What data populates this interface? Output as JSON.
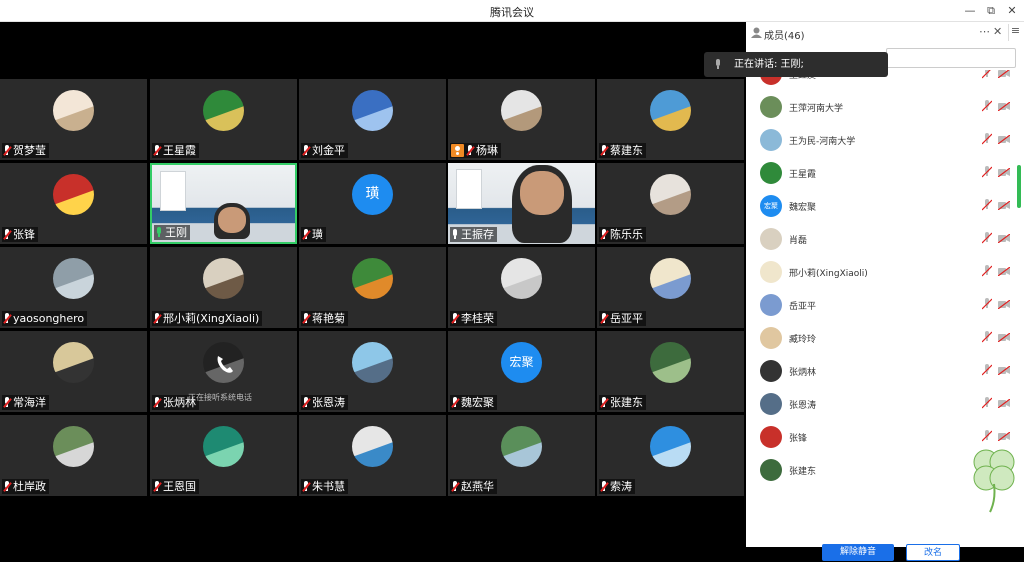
{
  "window": {
    "title": "腾讯会议"
  },
  "speaking": {
    "text": "正在讲话: 王刚;"
  },
  "grid": [
    [
      {
        "name": "贺梦莹",
        "mic": "muted"
      },
      {
        "name": "王星霞",
        "mic": "muted"
      },
      {
        "name": "刘金平",
        "mic": "muted"
      },
      {
        "name": "杨琳",
        "mic": "muted",
        "host": true
      },
      {
        "name": "蔡建东",
        "mic": "muted"
      }
    ],
    [
      {
        "name": "张锋",
        "mic": "muted"
      },
      {
        "name": "王刚",
        "mic": "active",
        "video": true
      },
      {
        "name": "璜",
        "mic": "muted",
        "initial": "璜"
      },
      {
        "name": "王振存",
        "mic": "on",
        "video": true
      },
      {
        "name": "陈乐乐",
        "mic": "muted"
      }
    ],
    [
      {
        "name": "yaosonghero",
        "mic": "muted"
      },
      {
        "name": "邢小莉(XingXiaoli)",
        "mic": "muted"
      },
      {
        "name": "蒋艳菊",
        "mic": "muted"
      },
      {
        "name": "李桂荣",
        "mic": "muted"
      },
      {
        "name": "岳亚平",
        "mic": "muted"
      }
    ],
    [
      {
        "name": "常海洋",
        "mic": "muted"
      },
      {
        "name": "张炳林",
        "mic": "muted",
        "phone": true
      },
      {
        "name": "张恩涛",
        "mic": "muted"
      },
      {
        "name": "魏宏聚",
        "mic": "muted",
        "initial": "宏聚"
      },
      {
        "name": "张建东",
        "mic": "muted"
      }
    ],
    [
      {
        "name": "杜岸政",
        "mic": "muted"
      },
      {
        "name": "王恩国",
        "mic": "muted"
      },
      {
        "name": "朱书慧",
        "mic": "muted"
      },
      {
        "name": "赵燕华",
        "mic": "muted"
      },
      {
        "name": "索涛",
        "mic": "muted"
      }
    ]
  ],
  "phone_caption": "正在接听系统电话",
  "panel": {
    "title": "成员(46)",
    "members": [
      "王红友",
      "王萍河南大学",
      "王为民-河南大学",
      "王星霞",
      "魏宏聚",
      "肖磊",
      "邢小莉(XingXiaoli)",
      "岳亚平",
      "臧玲玲",
      "张炳林",
      "张恩涛",
      "张锋",
      "张建东"
    ],
    "unmute_all": "解除静音",
    "rename": "改名"
  },
  "colors": {
    "accent": "#1a6fe8",
    "muted_red": "#e02020",
    "active_green": "#33cc66",
    "tile_bg": "#2b2b2b"
  }
}
